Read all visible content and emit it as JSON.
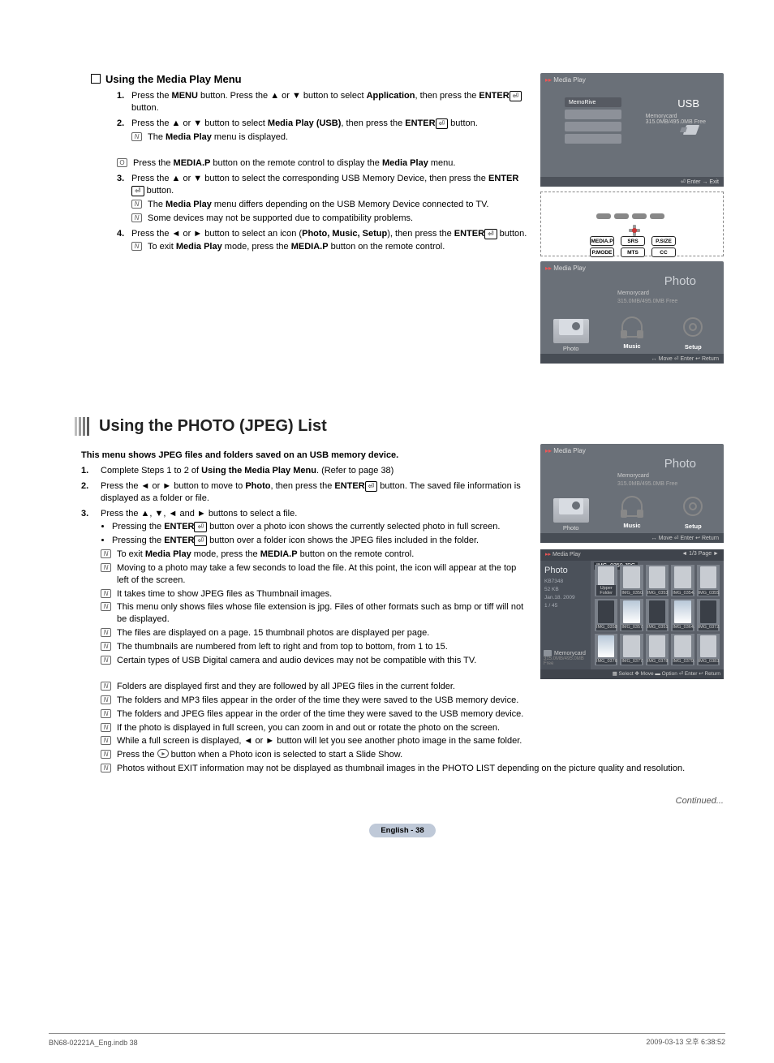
{
  "sectionA": {
    "heading": "Using the Media Play Menu",
    "steps": [
      {
        "num": "1.",
        "html": "Press the <b>MENU</b> button. Press the ▲ or ▼ button to select <b>Application</b>, then press the <b>ENTER</b><span class='enter-icon'>⏎</span> button."
      },
      {
        "num": "2.",
        "html": "Press the ▲ or ▼ button to select <b>Media Play (USB)</b>, then press the <b>ENTER</b><span class='enter-icon'>⏎</span> button.",
        "notes": [
          "The <b>Media Play</b> menu is displayed."
        ]
      },
      {
        "num": "",
        "html": "",
        "o_note": "Press the <b>MEDIA.P</b> button on the remote control to display the <b>Media Play</b> menu."
      },
      {
        "num": "3.",
        "html": "Press the ▲ or ▼ button to select the corresponding USB Memory Device, then press the <b>ENTER</b><span class='enter-icon'>⏎</span> button.",
        "notes": [
          "The <b>Media Play</b> menu differs depending on the USB Memory Device connected to TV.",
          "Some devices may not be supported due to compatibility problems."
        ]
      },
      {
        "num": "4.",
        "html": "Press the ◄ or ► button to select an icon (<b>Photo, Music, Setup</b>), then press the  <b>ENTER</b><span class='enter-icon'>⏎</span> button.",
        "notes": [
          "To exit <b>Media Play</b> mode, press the <b>MEDIA.P</b> button on the remote control."
        ]
      }
    ]
  },
  "screen1": {
    "hdr": "Media Play",
    "memo_sel": "MemoRive",
    "usb": "USB",
    "usb_sub1": "Memorycard",
    "usb_sub2": "315.0MB/495.0MB Free",
    "ftr": "⏎ Enter   → Exit"
  },
  "remote": {
    "b1": "MEDIA.P",
    "b2": "SRS",
    "b3": "P.SIZE",
    "b4": "P.MODE",
    "b5": "MTS",
    "b6": "CC"
  },
  "screen3": {
    "hdr": "Media Play",
    "title": "Photo",
    "sub1": "Memorycard",
    "sub2": "315.0MB/495.0MB Free",
    "cat1": "Photo",
    "cat2": "Music",
    "cat3": "Setup",
    "ftr": "↔ Move   ⏎ Enter   ↩ Return"
  },
  "sectionB": {
    "h1": "Using the PHOTO (JPEG) List",
    "intro": "This menu shows JPEG files and folders saved on an USB memory device.",
    "steps": [
      {
        "num": "1.",
        "html": "Complete Steps 1 to 2 of <b>Using the Media Play Menu</b>. (Refer to page 38)"
      },
      {
        "num": "2.",
        "html": "Press the ◄ or ► button to move to <b>Photo</b>, then press the <b>ENTER</b><span class='enter-icon'>⏎</span> button. The saved file information is displayed as a folder or file."
      },
      {
        "num": "3.",
        "html": "Press the ▲, ▼, ◄ and ► buttons to select a file.",
        "bullets": [
          "Pressing the <b>ENTER</b><span class='enter-icon'>⏎</span> button over a photo icon shows the currently selected photo in full screen.",
          "Pressing the <b>ENTER</b><span class='enter-icon'>⏎</span> button over a folder icon shows the JPEG files included in the folder."
        ],
        "notes": [
          "To exit <b>Media Play</b> mode, press the <b>MEDIA.P</b> button on the remote control.",
          "Moving to a photo may take a few seconds to load the file. At this point, the icon will appear at the top left of the screen.",
          "It takes time to show JPEG files as Thumbnail images.",
          "This menu only shows files whose file extension is jpg. Files of other formats such as bmp or tiff will not be displayed.",
          "The files are displayed on a page. 15 thumbnail photos are displayed per page.",
          "The thumbnails are numbered from left to right and from top to bottom, from 1 to 15.",
          "Certain types of USB Digital camera and audio devices may not be compatible with this TV."
        ]
      }
    ],
    "notes_wide": [
      "Folders are displayed first and they are followed by all JPEG files in the current folder.",
      "The folders and MP3 files appear in the order of the time they were saved to the USB memory device.",
      "The folders and JPEG files appear in the order of the time they were saved to the USB memory device.",
      "If the photo is displayed in full screen, you can zoom in and out or rotate the photo on the screen.",
      "While a full screen is displayed, ◄ or ► button will let you see another photo image in the same folder.",
      "Press the <span class='play-icon'></span> button when a Photo icon is selected to start a Slide Show.",
      "Photos without EXIT information may not be displayed as thumbnail images in the PHOTO LIST depending on the picture quality and resolution."
    ]
  },
  "screen4": {
    "hdr": "Media Play",
    "title": "Photo",
    "sub1": "Memorycard",
    "sub2": "315.0MB/495.0MB Free",
    "cat1": "Photo",
    "cat2": "Music",
    "cat3": "Setup",
    "ftr": "↔ Move   ⏎ Enter   ↩ Return"
  },
  "plist": {
    "hdr": "Media Play",
    "hdr_r": "◄   1/3 Page   ►",
    "title": "Photo",
    "file_sel": "IMG_0350.JPG",
    "meta1": "KB7348",
    "meta2": "52 KB",
    "meta3": "Jan.18. 2009",
    "meta4": "1 / 45",
    "mc_label": "Memorycard",
    "mc_free": "315.0MB/495.0MB Free",
    "thumbs": [
      "Upper Folder",
      "IMG_0350.JPG",
      "IMG_0353.JPG",
      "IMG_0354.JPG",
      "IMG_0355.JPG",
      "IMG_0358.JPG",
      "IMG_0357.JPG",
      "IMG_0351.JPG",
      "IMG_0364.JPG",
      "IMG_0372.JPG",
      "IMG_0376.JPG",
      "IMG_0377.JPG",
      "IMG_0378.JPG",
      "IMG_0379.JPG",
      "IMG_0383.JPG"
    ],
    "ftr": "▦ Select   ✥ Move   ▬ Option   ⏎ Enter   ↩ Return"
  },
  "continued": "Continued...",
  "pagenum": "English - 38",
  "footerL": "BN68-02221A_Eng.indb   38",
  "footerR": "2009-03-13   오후 6:38:52"
}
